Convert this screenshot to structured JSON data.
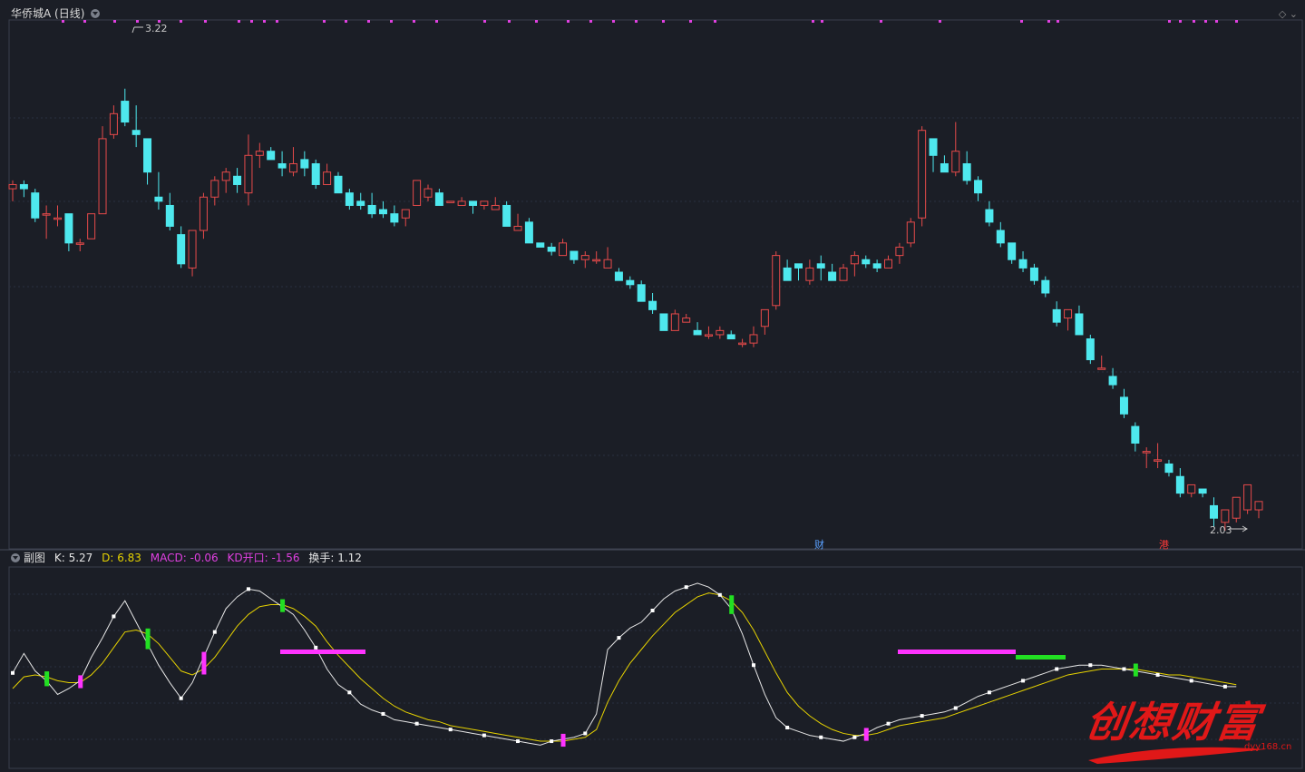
{
  "main_panel": {
    "title": "华侨城A (日线)",
    "high_label": "3.22",
    "low_label": "2.03",
    "markers": {
      "cai": "财",
      "gang": "港"
    },
    "colors": {
      "up": "#e64a4a",
      "down": "#4ee8ee",
      "grid": "#2a3040",
      "background": "#1b1e26"
    }
  },
  "sub_panel": {
    "title": "副图",
    "legend": [
      {
        "label": "K: 5.27",
        "color": "#e6e6e6"
      },
      {
        "label": "D: 6.83",
        "color": "#e6d200"
      },
      {
        "label": "MACD: -0.06",
        "color": "#e040e0"
      },
      {
        "label": "KD开口: -1.56",
        "color": "#e040e0"
      },
      {
        "label": "换手: 1.12",
        "color": "#e6e6e6"
      }
    ]
  },
  "watermark": {
    "text": "创想财富",
    "url": "dyy168.cn"
  },
  "chart_data": {
    "type": "candlestick",
    "candles": [
      [
        2.85,
        2.86,
        2.82,
        2.87
      ],
      [
        2.86,
        2.85,
        2.83,
        2.87
      ],
      [
        2.84,
        2.78,
        2.77,
        2.85
      ],
      [
        2.79,
        2.79,
        2.73,
        2.81
      ],
      [
        2.78,
        2.78,
        2.76,
        2.81
      ],
      [
        2.79,
        2.72,
        2.7,
        2.79
      ],
      [
        2.72,
        2.72,
        2.7,
        2.73
      ],
      [
        2.73,
        2.79,
        2.73,
        2.79
      ],
      [
        2.79,
        2.97,
        2.79,
        3.0
      ],
      [
        2.98,
        3.03,
        2.97,
        3.05
      ],
      [
        3.06,
        3.01,
        3.0,
        3.09
      ],
      [
        2.99,
        2.98,
        2.95,
        3.05
      ],
      [
        2.97,
        2.89,
        2.86,
        2.96
      ],
      [
        2.83,
        2.82,
        2.8,
        2.89
      ],
      [
        2.81,
        2.76,
        2.75,
        2.84
      ],
      [
        2.74,
        2.67,
        2.66,
        2.76
      ],
      [
        2.66,
        2.75,
        2.64,
        2.75
      ],
      [
        2.75,
        2.83,
        2.73,
        2.84
      ],
      [
        2.83,
        2.87,
        2.81,
        2.88
      ],
      [
        2.87,
        2.89,
        2.84,
        2.9
      ],
      [
        2.88,
        2.86,
        2.84,
        2.9
      ],
      [
        2.84,
        2.93,
        2.81,
        2.98
      ],
      [
        2.93,
        2.94,
        2.9,
        2.96
      ],
      [
        2.94,
        2.92,
        2.92,
        2.95
      ],
      [
        2.91,
        2.9,
        2.88,
        2.94
      ],
      [
        2.89,
        2.91,
        2.88,
        2.95
      ],
      [
        2.92,
        2.9,
        2.88,
        2.94
      ],
      [
        2.91,
        2.86,
        2.85,
        2.92
      ],
      [
        2.86,
        2.89,
        2.86,
        2.91
      ],
      [
        2.88,
        2.84,
        2.84,
        2.89
      ],
      [
        2.84,
        2.81,
        2.8,
        2.85
      ],
      [
        2.82,
        2.81,
        2.8,
        2.84
      ],
      [
        2.81,
        2.79,
        2.78,
        2.84
      ],
      [
        2.8,
        2.79,
        2.78,
        2.82
      ],
      [
        2.79,
        2.77,
        2.76,
        2.81
      ],
      [
        2.78,
        2.8,
        2.76,
        2.8
      ],
      [
        2.81,
        2.87,
        2.82,
        2.87
      ],
      [
        2.83,
        2.85,
        2.82,
        2.86
      ],
      [
        2.84,
        2.81,
        2.81,
        2.85
      ],
      [
        2.82,
        2.82,
        2.82,
        2.82
      ],
      [
        2.81,
        2.82,
        2.81,
        2.83
      ],
      [
        2.82,
        2.81,
        2.79,
        2.82
      ],
      [
        2.81,
        2.82,
        2.8,
        2.81
      ],
      [
        2.8,
        2.81,
        2.8,
        2.83
      ],
      [
        2.81,
        2.76,
        2.76,
        2.82
      ],
      [
        2.75,
        2.76,
        2.76,
        2.79
      ],
      [
        2.77,
        2.72,
        2.72,
        2.78
      ],
      [
        2.72,
        2.71,
        2.71,
        2.72
      ],
      [
        2.71,
        2.7,
        2.69,
        2.72
      ],
      [
        2.69,
        2.72,
        2.69,
        2.73
      ],
      [
        2.7,
        2.68,
        2.67,
        2.7
      ],
      [
        2.68,
        2.69,
        2.66,
        2.7
      ],
      [
        2.68,
        2.68,
        2.67,
        2.7
      ],
      [
        2.66,
        2.68,
        2.67,
        2.71
      ],
      [
        2.65,
        2.63,
        2.63,
        2.66
      ],
      [
        2.63,
        2.62,
        2.61,
        2.64
      ],
      [
        2.62,
        2.58,
        2.58,
        2.63
      ],
      [
        2.58,
        2.56,
        2.55,
        2.6
      ],
      [
        2.55,
        2.51,
        2.51,
        2.55
      ],
      [
        2.51,
        2.55,
        2.51,
        2.56
      ],
      [
        2.53,
        2.54,
        2.53,
        2.55
      ],
      [
        2.51,
        2.5,
        2.5,
        2.53
      ],
      [
        2.5,
        2.5,
        2.49,
        2.52
      ],
      [
        2.5,
        2.51,
        2.49,
        2.52
      ],
      [
        2.5,
        2.49,
        2.49,
        2.51
      ],
      [
        2.48,
        2.48,
        2.47,
        2.49
      ],
      [
        2.48,
        2.5,
        2.47,
        2.52
      ],
      [
        2.52,
        2.56,
        2.5,
        2.56
      ],
      [
        2.57,
        2.69,
        2.56,
        2.7
      ],
      [
        2.66,
        2.63,
        2.63,
        2.68
      ],
      [
        2.67,
        2.66,
        2.63,
        2.67
      ],
      [
        2.63,
        2.66,
        2.62,
        2.68
      ],
      [
        2.67,
        2.66,
        2.63,
        2.69
      ],
      [
        2.65,
        2.63,
        2.63,
        2.67
      ],
      [
        2.63,
        2.66,
        2.63,
        2.67
      ],
      [
        2.67,
        2.69,
        2.64,
        2.7
      ],
      [
        2.68,
        2.67,
        2.66,
        2.69
      ],
      [
        2.67,
        2.66,
        2.65,
        2.68
      ],
      [
        2.66,
        2.68,
        2.66,
        2.69
      ],
      [
        2.69,
        2.71,
        2.67,
        2.72
      ],
      [
        2.72,
        2.77,
        2.71,
        2.78
      ],
      [
        2.78,
        2.99,
        2.76,
        3.0
      ],
      [
        2.97,
        2.93,
        2.89,
        2.97
      ],
      [
        2.91,
        2.89,
        2.89,
        2.93
      ],
      [
        2.89,
        2.94,
        2.88,
        3.01
      ],
      [
        2.91,
        2.87,
        2.86,
        2.94
      ],
      [
        2.87,
        2.84,
        2.82,
        2.88
      ],
      [
        2.8,
        2.77,
        2.76,
        2.82
      ],
      [
        2.75,
        2.72,
        2.71,
        2.77
      ],
      [
        2.72,
        2.68,
        2.67,
        2.72
      ],
      [
        2.68,
        2.66,
        2.65,
        2.7
      ],
      [
        2.66,
        2.63,
        2.62,
        2.67
      ],
      [
        2.63,
        2.6,
        2.59,
        2.64
      ],
      [
        2.56,
        2.53,
        2.52,
        2.58
      ],
      [
        2.54,
        2.56,
        2.51,
        2.56
      ],
      [
        2.55,
        2.5,
        2.5,
        2.57
      ],
      [
        2.49,
        2.44,
        2.43,
        2.5
      ],
      [
        2.42,
        2.42,
        2.42,
        2.45
      ],
      [
        2.4,
        2.38,
        2.37,
        2.42
      ],
      [
        2.35,
        2.31,
        2.3,
        2.37
      ],
      [
        2.28,
        2.24,
        2.22,
        2.29
      ],
      [
        2.22,
        2.22,
        2.18,
        2.23
      ],
      [
        2.2,
        2.2,
        2.18,
        2.24
      ],
      [
        2.19,
        2.17,
        2.16,
        2.2
      ],
      [
        2.16,
        2.12,
        2.11,
        2.18
      ],
      [
        2.12,
        2.14,
        2.11,
        2.14
      ],
      [
        2.13,
        2.12,
        2.11,
        2.13
      ],
      [
        2.09,
        2.06,
        2.04,
        2.11
      ],
      [
        2.05,
        2.08,
        2.03,
        2.08
      ],
      [
        2.06,
        2.11,
        2.05,
        2.11
      ],
      [
        2.08,
        2.14,
        2.07,
        2.14
      ],
      [
        2.08,
        2.1,
        2.06,
        2.1
      ]
    ],
    "indicator": {
      "k": [
        48,
        58,
        49,
        44,
        37,
        40,
        44,
        56,
        66,
        77,
        85,
        74,
        63,
        52,
        43,
        35,
        43,
        56,
        69,
        81,
        87,
        91,
        90,
        86,
        82,
        78,
        70,
        61,
        50,
        42,
        38,
        32,
        29,
        27,
        24,
        23,
        22,
        21,
        20,
        19,
        18,
        17,
        16,
        15,
        14,
        13,
        12,
        11,
        13,
        14,
        15,
        17,
        27,
        60,
        66,
        71,
        74,
        80,
        86,
        90,
        92,
        94,
        92,
        88,
        81,
        68,
        52,
        37,
        25,
        20,
        18,
        16,
        15,
        14,
        13,
        15,
        17,
        20,
        22,
        24,
        25,
        26,
        27,
        28,
        30,
        33,
        36,
        38,
        40,
        42,
        44,
        46,
        48,
        50,
        51,
        52,
        52,
        52,
        51,
        50,
        49,
        48,
        47,
        46,
        45,
        44,
        43,
        42,
        41,
        41
      ],
      "d": [
        40,
        46,
        47,
        46,
        44,
        43,
        43,
        47,
        53,
        61,
        69,
        70,
        68,
        63,
        56,
        49,
        47,
        50,
        56,
        64,
        72,
        78,
        82,
        83,
        83,
        81,
        77,
        72,
        64,
        57,
        51,
        45,
        40,
        35,
        31,
        28,
        26,
        24,
        23,
        21,
        20,
        19,
        18,
        17,
        16,
        15,
        14,
        13,
        13,
        13,
        14,
        15,
        19,
        33,
        44,
        53,
        60,
        67,
        73,
        79,
        83,
        87,
        89,
        88,
        85,
        79,
        70,
        59,
        48,
        38,
        31,
        26,
        22,
        19,
        17,
        16,
        16,
        17,
        19,
        21,
        22,
        23,
        24,
        25,
        27,
        29,
        31,
        33,
        35,
        37,
        39,
        41,
        43,
        45,
        47,
        48,
        49,
        50,
        50,
        50,
        50,
        49,
        48,
        47,
        47,
        46,
        45,
        44,
        43,
        42
      ]
    }
  }
}
